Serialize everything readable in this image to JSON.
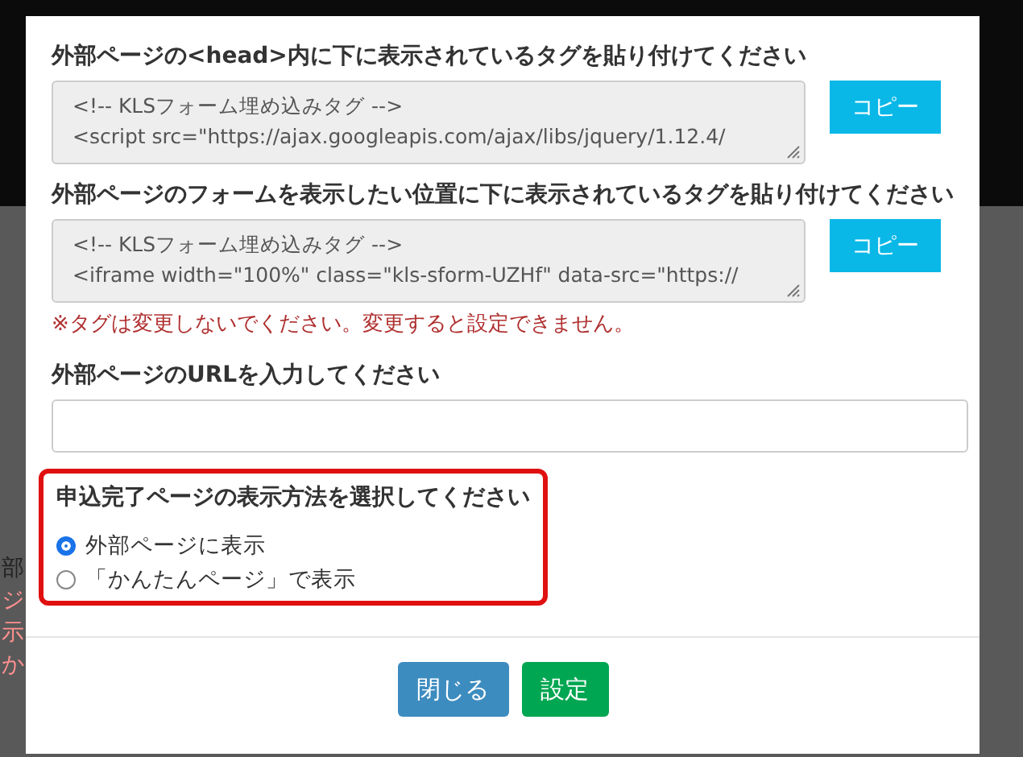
{
  "background_fragments": [
    {
      "text": "部",
      "kind": "plain"
    },
    {
      "text": "ジ",
      "kind": "warning"
    },
    {
      "text": "示",
      "kind": "warning"
    },
    {
      "text": "か",
      "kind": "warning"
    }
  ],
  "modal": {
    "sections": [
      {
        "kind": "code",
        "label": "外部ページの<head>内に下に表示されているタグを貼り付けてください",
        "lines": [
          "<!-- KLSフォーム埋め込みタグ -->",
          "<script src=\"https://ajax.googleapis.com/ajax/libs/jquery/1.12.4/"
        ],
        "button": "コピー"
      },
      {
        "kind": "code",
        "label": "外部ページのフォームを表示したい位置に下に表示されているタグを貼り付けてください",
        "lines": [
          "<!-- KLSフォーム埋め込みタグ -->",
          "<iframe width=\"100%\" class=\"kls-sform-UZHf\" data-src=\"https://"
        ],
        "button": "コピー",
        "note": "※タグは変更しないでください。変更すると設定できません。"
      },
      {
        "kind": "input",
        "label": "外部ページのURLを入力してください"
      },
      {
        "kind": "radio",
        "label": "申込完了ページの表示方法を選択してください",
        "highlighted": true,
        "options": [
          {
            "label": "外部ページに表示",
            "selected": true
          },
          {
            "label": "「かんたんページ」で表示",
            "selected": false
          }
        ]
      }
    ],
    "buttons": [
      {
        "label": "閉じる",
        "kind": "close"
      },
      {
        "label": "設定",
        "kind": "primary"
      }
    ]
  }
}
